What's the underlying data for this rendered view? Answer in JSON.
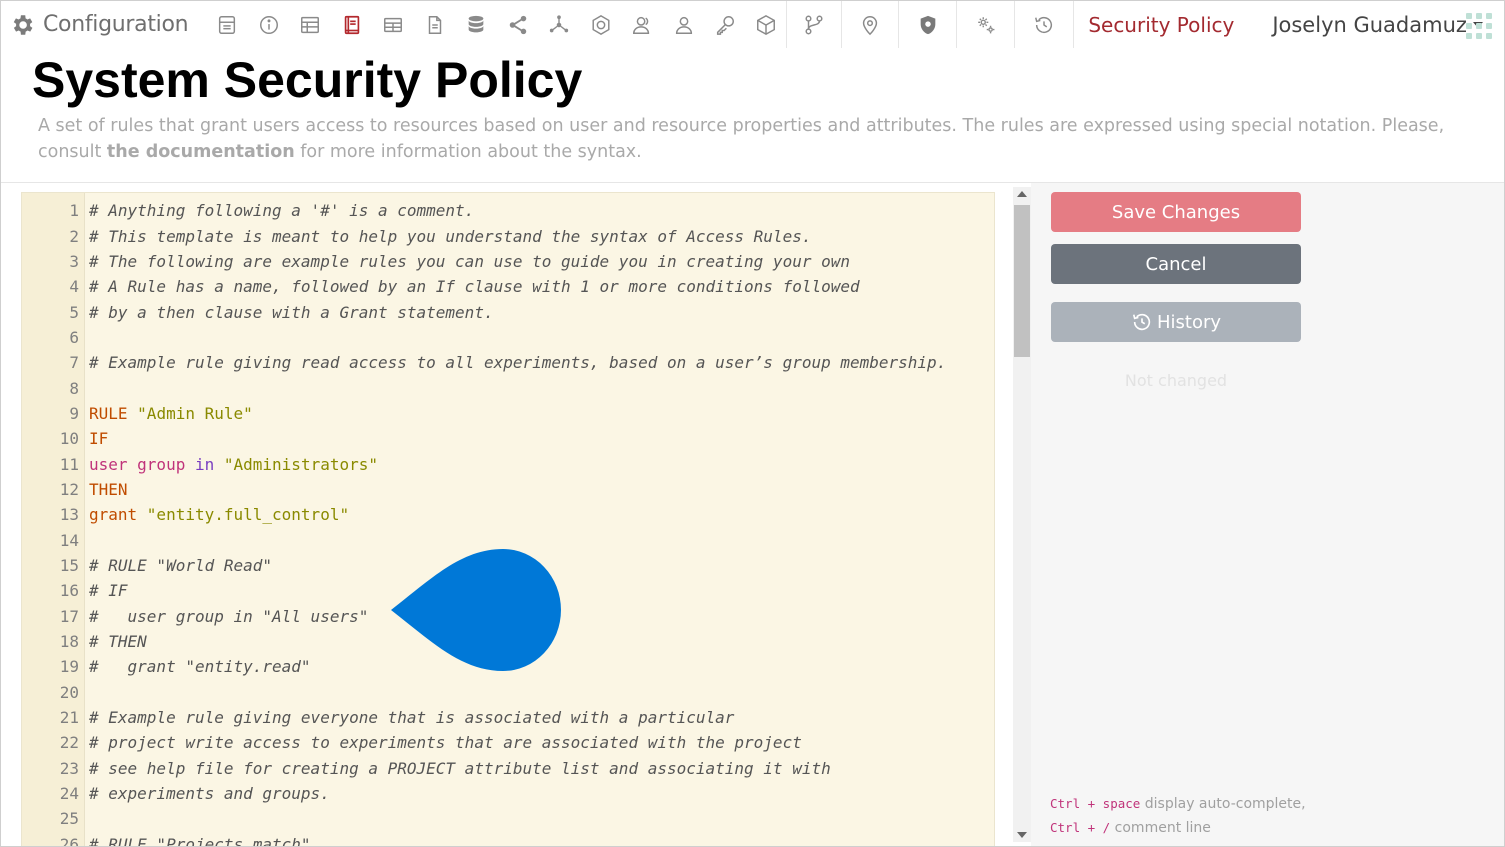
{
  "nav": {
    "brand": "Configuration",
    "icons": [
      "dashboard-icon",
      "info-icon",
      "table-icon",
      "book-icon",
      "grid-icon",
      "document-icon",
      "database-icon",
      "share-icon",
      "network-icon",
      "cd-icon",
      "user-group-icon",
      "user-icon",
      "key-icon",
      "cube-icon",
      "branch-icon",
      "location-pin-icon",
      "shield-icon",
      "settings-cogs-icon",
      "history-icon"
    ],
    "active_icon": "book-icon",
    "section": "Security Policy",
    "user": "Joselyn Guadamuz"
  },
  "header": {
    "title": "System Security Policy",
    "description_pre": "A set of rules that grant users access to resources based on user and resource properties and attributes. The rules are expressed using special notation. Please, consult ",
    "description_link": "the documentation",
    "description_post": " for more information about the syntax."
  },
  "editor": {
    "lines": [
      {
        "n": "1",
        "text": "# Anything following a '#' is a comment.",
        "type": "comment"
      },
      {
        "n": "2",
        "text": "# This template is meant to help you understand the syntax of Access Rules.",
        "type": "comment"
      },
      {
        "n": "3",
        "text": "# The following are example rules you can use to guide you in creating your own",
        "type": "comment"
      },
      {
        "n": "4",
        "text": "# A Rule has a name, followed by an If clause with 1 or more conditions followed",
        "type": "comment"
      },
      {
        "n": "5",
        "text": "# by a then clause with a Grant statement.",
        "type": "comment"
      },
      {
        "n": "6",
        "text": "",
        "type": "blank"
      },
      {
        "n": "7",
        "text": "# Example rule giving read access to all experiments, based on a user’s group membership.",
        "type": "comment"
      },
      {
        "n": "8",
        "text": "",
        "type": "blank"
      },
      {
        "n": "9",
        "tokens": [
          {
            "t": "RULE ",
            "c": "kw"
          },
          {
            "t": "\"Admin Rule\"",
            "c": "str"
          }
        ]
      },
      {
        "n": "10",
        "tokens": [
          {
            "t": "IF",
            "c": "kw"
          }
        ]
      },
      {
        "n": "11",
        "tokens": [
          {
            "t": "user group ",
            "c": "var"
          },
          {
            "t": "in ",
            "c": "op"
          },
          {
            "t": "\"Administrators\"",
            "c": "str"
          }
        ]
      },
      {
        "n": "12",
        "tokens": [
          {
            "t": "THEN",
            "c": "kw"
          }
        ]
      },
      {
        "n": "13",
        "tokens": [
          {
            "t": "grant ",
            "c": "kw"
          },
          {
            "t": "\"entity.full_control\"",
            "c": "str"
          }
        ]
      },
      {
        "n": "14",
        "text": "",
        "type": "blank"
      },
      {
        "n": "15",
        "text": "# RULE \"World Read\"",
        "type": "comment"
      },
      {
        "n": "16",
        "text": "# IF",
        "type": "comment"
      },
      {
        "n": "17",
        "text": "#   user group in \"All users\"",
        "type": "comment"
      },
      {
        "n": "18",
        "text": "# THEN",
        "type": "comment"
      },
      {
        "n": "19",
        "text": "#   grant \"entity.read\"",
        "type": "comment"
      },
      {
        "n": "20",
        "text": "",
        "type": "blank"
      },
      {
        "n": "21",
        "text": "# Example rule giving everyone that is associated with a particular",
        "type": "comment"
      },
      {
        "n": "22",
        "text": "# project write access to experiments that are associated with the project",
        "type": "comment"
      },
      {
        "n": "23",
        "text": "# see help file for creating a PROJECT attribute list and associating it with",
        "type": "comment"
      },
      {
        "n": "24",
        "text": "# experiments and groups.",
        "type": "comment"
      },
      {
        "n": "25",
        "text": "",
        "type": "blank"
      },
      {
        "n": "26",
        "text": "# RULE \"Projects match\"",
        "type": "comment"
      }
    ]
  },
  "side": {
    "save_label": "Save Changes",
    "cancel_label": "Cancel",
    "history_label": "History",
    "status": "Not changed",
    "hint_key1": "Ctrl + space",
    "hint_text1": " display auto-complete, ",
    "hint_key2": "Ctrl + /",
    "hint_text2": " comment line"
  },
  "colors": {
    "accent": "#a32a30",
    "save_button": "#e57c84",
    "cancel_button": "#6c737c",
    "history_button": "#abb2ba",
    "editor_bg": "#fbf6e4",
    "marker": "#0078d7"
  }
}
